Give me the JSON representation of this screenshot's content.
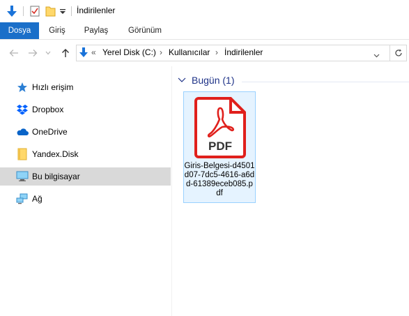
{
  "window": {
    "title": "İndirilenler"
  },
  "ribbon": {
    "tabs": [
      "Dosya",
      "Giriş",
      "Paylaş",
      "Görünüm"
    ]
  },
  "address": {
    "overflow": "«",
    "parts": [
      "Yerel Disk (C:)",
      "Kullanıcılar",
      "İndirilenler"
    ]
  },
  "sidebar": {
    "items": [
      {
        "label": "Hızlı erişim",
        "icon": "star-icon"
      },
      {
        "label": "Dropbox",
        "icon": "dropbox-icon"
      },
      {
        "label": "OneDrive",
        "icon": "cloud-icon"
      },
      {
        "label": "Yandex.Disk",
        "icon": "folder-icon"
      },
      {
        "label": "Bu bilgisayar",
        "icon": "computer-icon",
        "selected": true
      },
      {
        "label": "Ağ",
        "icon": "network-icon"
      }
    ]
  },
  "content": {
    "group_title": "Bugün (1)",
    "files": [
      {
        "name": "Giris-Belgesi-d4501d07-7dc5-4616-a6dd-61389eceb085.pdf",
        "type_label": "PDF",
        "icon": "pdf-file-icon"
      }
    ]
  },
  "colors": {
    "accent": "#1a6fc9",
    "pdf_red": "#e0201c",
    "selection_bg": "#e5f3ff",
    "selection_border": "#99d1ff",
    "group_header": "#1e3287"
  }
}
